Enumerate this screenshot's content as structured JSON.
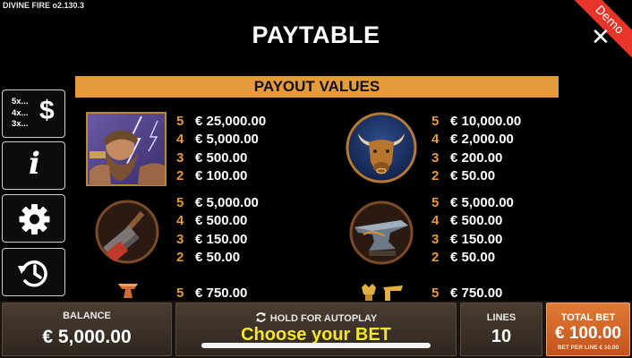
{
  "version_label": "DIVINE FIRE  o2.130.3",
  "demo_label": "Demo",
  "title": "PAYTABLE",
  "close_glyph": "✕",
  "payout_header": "PAYOUT VALUES",
  "side_buttons": {
    "multipliers": [
      "5x...",
      "4x...",
      "3x..."
    ],
    "dollar": "$",
    "info": "i",
    "settings_icon": "gear-icon",
    "history_icon": "history-icon"
  },
  "paytable": [
    {
      "symbol": "zeus",
      "rows": [
        {
          "count": "5",
          "amount": "€ 25,000.00"
        },
        {
          "count": "4",
          "amount": "€ 5,000.00"
        },
        {
          "count": "3",
          "amount": "€ 500.00"
        },
        {
          "count": "2",
          "amount": "€ 100.00"
        }
      ]
    },
    {
      "symbol": "bull",
      "rows": [
        {
          "count": "5",
          "amount": "€ 10,000.00"
        },
        {
          "count": "4",
          "amount": "€ 2,000.00"
        },
        {
          "count": "3",
          "amount": "€ 200.00"
        },
        {
          "count": "2",
          "amount": "€ 50.00"
        }
      ]
    },
    {
      "symbol": "hammer",
      "rows": [
        {
          "count": "5",
          "amount": "€ 5,000.00"
        },
        {
          "count": "4",
          "amount": "€ 500.00"
        },
        {
          "count": "3",
          "amount": "€ 150.00"
        },
        {
          "count": "2",
          "amount": "€ 50.00"
        }
      ]
    },
    {
      "symbol": "anvil",
      "rows": [
        {
          "count": "5",
          "amount": "€ 5,000.00"
        },
        {
          "count": "4",
          "amount": "€ 500.00"
        },
        {
          "count": "3",
          "amount": "€ 150.00"
        },
        {
          "count": "2",
          "amount": "€ 50.00"
        }
      ]
    },
    {
      "symbol": "small-anvil",
      "rows": [
        {
          "count": "5",
          "amount": "€ 750.00"
        }
      ]
    },
    {
      "symbol": "tools",
      "rows": [
        {
          "count": "5",
          "amount": "€ 750.00"
        }
      ]
    }
  ],
  "bottom": {
    "balance_label": "BALANCE",
    "balance_value": "€ 5,000.00",
    "autoplay_label": "HOLD FOR AUTOPLAY",
    "choose_bet": "Choose your BET",
    "lines_label": "LINES",
    "lines_value": "10",
    "total_bet_label": "TOTAL BET",
    "total_bet_value": "€ 100.00",
    "bet_per_line": "BET PER LINE € 10.00"
  },
  "colors": {
    "accent": "#e59a3c",
    "choose_bet": "#f5e62a",
    "demo_ribbon": "#e8352b",
    "total_bet_panel": "#d8662a"
  }
}
